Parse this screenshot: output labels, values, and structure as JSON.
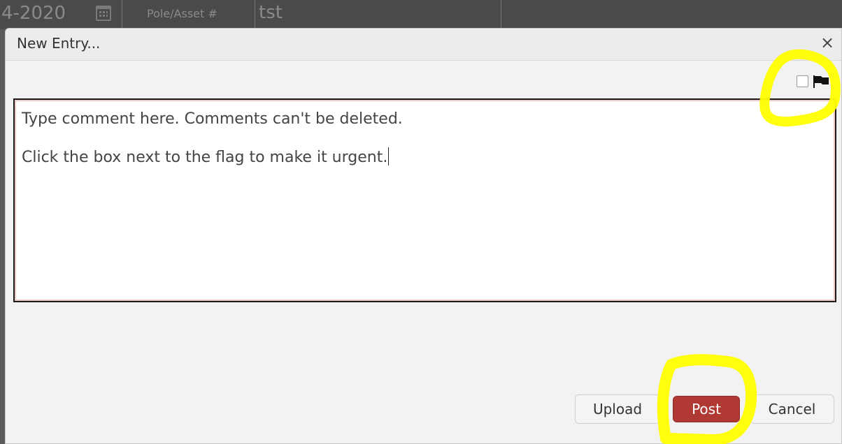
{
  "background": {
    "date_fragment": "4-2020",
    "pole_label": "Pole/Asset #",
    "pole_value": "tst"
  },
  "dialog": {
    "title": "New Entry...",
    "close_glyph": "×",
    "urgent_checkbox_checked": false,
    "flag_icon": "flag-icon",
    "comment_line1": "Type comment here.  Comments can't be deleted.",
    "comment_line2": "Click the box next to the flag to make it urgent.",
    "buttons": {
      "upload": "Upload",
      "post": "Post",
      "cancel": "Cancel"
    }
  },
  "colors": {
    "post_button": "#b03a33",
    "highlight": "#ffff00"
  }
}
